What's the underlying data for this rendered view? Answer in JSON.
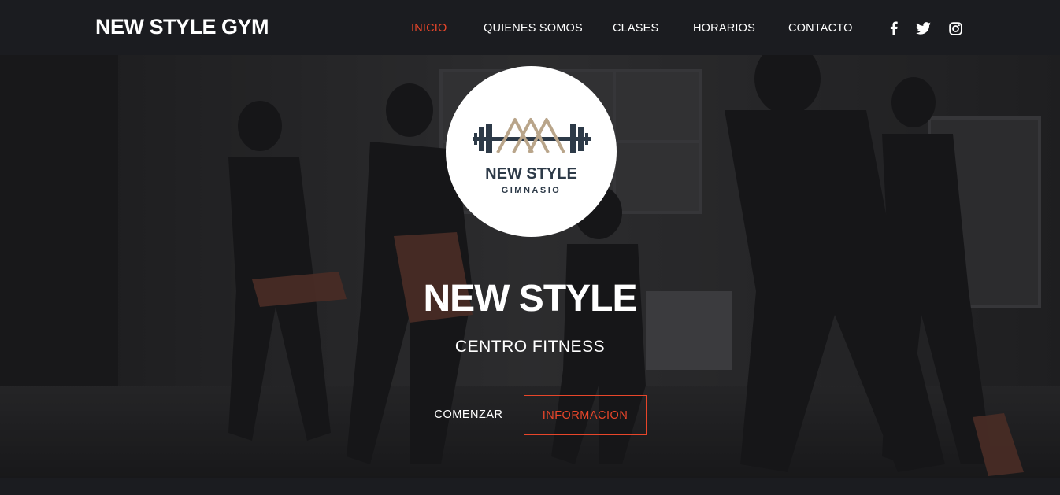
{
  "brand": {
    "name": "NEW STYLE GYM"
  },
  "nav": {
    "items": [
      {
        "label": "INICIO",
        "active": true
      },
      {
        "label": "QUIENES SOMOS",
        "active": false
      },
      {
        "label": "CLASES",
        "active": false
      },
      {
        "label": "HORARIOS",
        "active": false
      },
      {
        "label": "CONTACTO",
        "active": false
      }
    ],
    "social": [
      "facebook-icon",
      "twitter-icon",
      "instagram-icon"
    ]
  },
  "hero": {
    "logo": {
      "line1": "NEW STYLE",
      "line2": "GIMNASIO"
    },
    "title": "NEW STYLE",
    "subtitle": "CENTRO FITNESS",
    "buttons": {
      "start": "COMENZAR",
      "info": "INFORMACION"
    }
  },
  "colors": {
    "accent": "#e8462a",
    "navbar_bg": "#1b1c20",
    "logo_dark": "#2d3a48",
    "logo_gold": "#b9a58a"
  }
}
